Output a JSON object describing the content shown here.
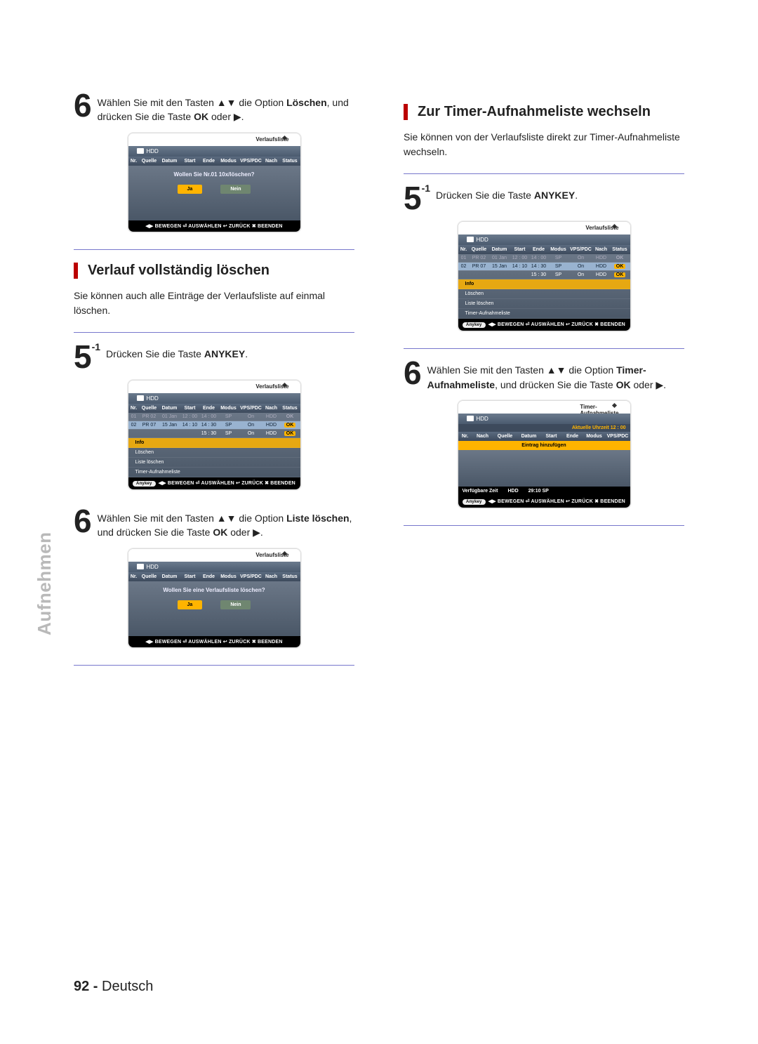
{
  "page_footer": {
    "num": "92 -",
    "lang": "Deutsch"
  },
  "side_label": "Aufnehmen",
  "left": {
    "step6a": {
      "num": "6",
      "pre": "Wählen Sie mit den Tasten ▲▼ die Option ",
      "bold": "Löschen",
      "post": ", und drücken Sie die Taste ",
      "bold2": "OK",
      "post2": " oder ▶."
    },
    "shot1": {
      "title": "Verlaufsliste",
      "bar": "HDD",
      "hdr": [
        "Nr.",
        "Quelle",
        "Datum",
        "Start",
        "Ende",
        "Modus",
        "VPS/PDC",
        "Nach",
        "Status"
      ],
      "dialog_msg": "Wollen Sie Nr.01 10x/löschen?",
      "btn_yes": "Ja",
      "btn_no": "Nein",
      "footer": "◀▶ BEWEGEN   ⏎ AUSWÄHLEN   ↩ ZURÜCK   ✖ BEENDEN"
    },
    "h2": "Verlauf vollständig löschen",
    "lead": "Sie können auch alle Einträge der Verlaufsliste auf einmal löschen.",
    "step5": {
      "num": "5",
      "sup": "-1",
      "text_pre": "Drücken Sie die Taste ",
      "bold": "ANYKEY",
      "post": "."
    },
    "shot2": {
      "title": "Verlaufsliste",
      "bar": "HDD",
      "hdr": [
        "Nr.",
        "Quelle",
        "Datum",
        "Start",
        "Ende",
        "Modus",
        "VPS/PDC",
        "Nach",
        "Status"
      ],
      "rows": [
        {
          "cells": [
            "01",
            "PR 02",
            "01 Jan",
            "12 : 00",
            "14 : 00",
            "SP",
            "On",
            "HDD",
            "OK"
          ],
          "dim": true
        },
        {
          "cells": [
            "02",
            "PR 07",
            "15 Jan",
            "14 : 10",
            "14 : 30",
            "SP",
            "On",
            "HDD",
            "OK"
          ],
          "hl": true
        },
        {
          "cells": [
            "",
            "",
            "",
            "",
            "15 : 30",
            "SP",
            "On",
            "HDD",
            "OK"
          ]
        }
      ],
      "menu": [
        "Info",
        "Löschen",
        "Liste löschen",
        "Timer-Aufnahmeliste"
      ],
      "footer_key": "Anykey",
      "footer": "◀▶ BEWEGEN   ⏎ AUSWÄHLEN   ↩ ZURÜCK   ✖ BEENDEN"
    },
    "step6b": {
      "num": "6",
      "pre": "Wählen Sie mit den Tasten ▲▼ die Option ",
      "bold": "Liste löschen",
      "post": ", und drücken Sie die Taste ",
      "bold2": "OK",
      "post2": " oder ▶."
    },
    "shot3": {
      "title": "Verlaufsliste",
      "bar": "HDD",
      "hdr": [
        "Nr.",
        "Quelle",
        "Datum",
        "Start",
        "Ende",
        "Modus",
        "VPS/PDC",
        "Nach",
        "Status"
      ],
      "dialog_msg": "Wollen Sie eine Verlaufsliste löschen?",
      "btn_yes": "Ja",
      "btn_no": "Nein",
      "footer": "◀▶ BEWEGEN   ⏎ AUSWÄHLEN   ↩ ZURÜCK   ✖ BEENDEN"
    }
  },
  "right": {
    "h2": "Zur Timer-Aufnahmeliste wechseln",
    "lead": "Sie können von der Verlaufsliste direkt zur Timer-Aufnahmeliste wechseln.",
    "step5": {
      "num": "5",
      "sup": "-1",
      "text_pre": "Drücken Sie die Taste ",
      "bold": "ANYKEY",
      "post": "."
    },
    "shot1": {
      "title": "Verlaufsliste",
      "bar": "HDD",
      "hdr": [
        "Nr.",
        "Quelle",
        "Datum",
        "Start",
        "Ende",
        "Modus",
        "VPS/PDC",
        "Nach",
        "Status"
      ],
      "rows": [
        {
          "cells": [
            "01",
            "PR 02",
            "01 Jan",
            "12 : 00",
            "14 : 00",
            "SP",
            "On",
            "HDD",
            "OK"
          ],
          "dim": true
        },
        {
          "cells": [
            "02",
            "PR 07",
            "15 Jan",
            "14 : 10",
            "14 : 30",
            "SP",
            "On",
            "HDD",
            "OK"
          ],
          "hl": true
        },
        {
          "cells": [
            "",
            "",
            "",
            "",
            "15 : 30",
            "SP",
            "On",
            "HDD",
            "OK"
          ]
        }
      ],
      "menu": [
        "Info",
        "Löschen",
        "Liste löschen",
        "Timer-Aufnahmeliste"
      ],
      "footer_key": "Anykey",
      "footer": "◀▶ BEWEGEN   ⏎ AUSWÄHLEN   ↩ ZURÜCK   ✖ BEENDEN"
    },
    "step6": {
      "num": "6",
      "pre": "Wählen Sie mit den Tasten ▲▼ die Option ",
      "bold": "Timer-Aufnahmeliste",
      "post": ", und drücken Sie die Taste ",
      "bold2": "OK",
      "post2": " oder ▶."
    },
    "shot2": {
      "title": "Timer-Aufnahmeliste",
      "bar": "HDD",
      "time_label": "Aktuelle Uhrzeit 12 : 00",
      "hdr": [
        "Nr.",
        "Nach",
        "Quelle",
        "Datum",
        "Start",
        "Ende",
        "Modus",
        "VPS/PDC"
      ],
      "add": "Eintrag hinzufügen",
      "avail_label": "Verfügbare Zeit",
      "avail_dev": "HDD",
      "avail_time": "29:10 SP",
      "footer_key": "Anykey",
      "footer": "◀▶ BEWEGEN   ⏎ AUSWÄHLEN   ↩ ZURÜCK   ✖ BEENDEN"
    }
  }
}
